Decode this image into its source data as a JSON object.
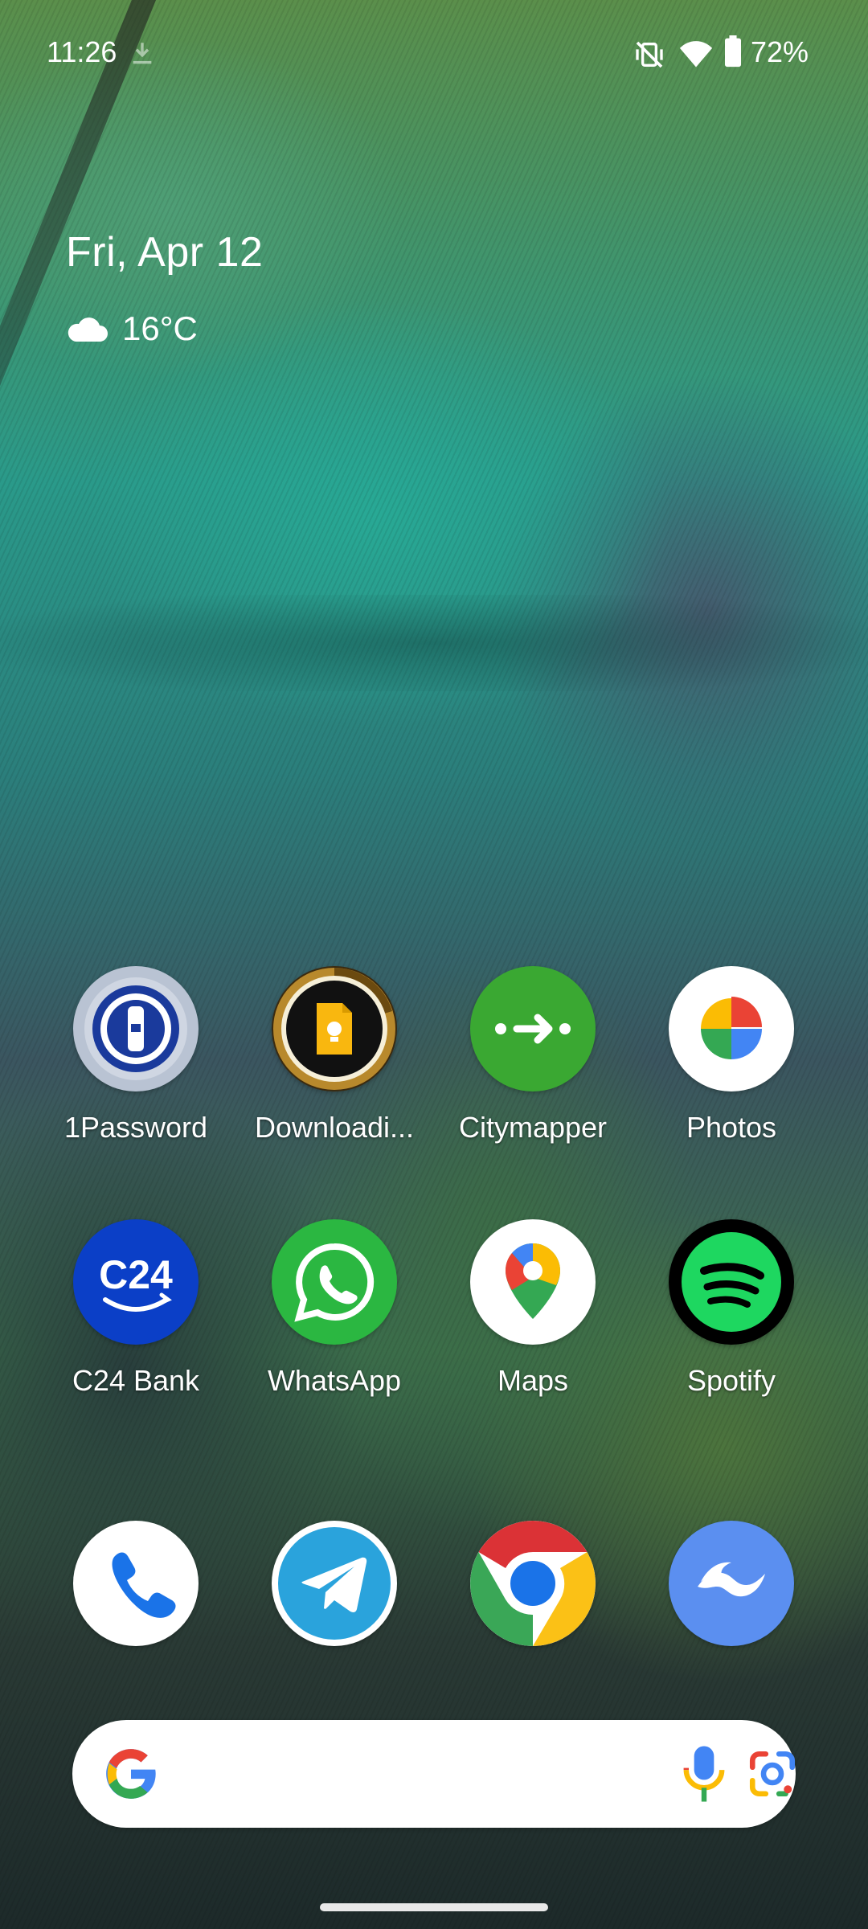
{
  "status_bar": {
    "time": "11:26",
    "battery": "72%",
    "icons": [
      "download-icon",
      "vibrate-off-icon",
      "wifi-icon",
      "battery-icon"
    ]
  },
  "glance": {
    "date": "Fri, Apr 12",
    "temperature": "16°C",
    "weather_icon": "cloud-icon"
  },
  "apps_row1": [
    {
      "label": "1Password",
      "icon": "1password-icon"
    },
    {
      "label": "Downloadi...",
      "icon": "google-keep-icon"
    },
    {
      "label": "Citymapper",
      "icon": "citymapper-icon"
    },
    {
      "label": "Photos",
      "icon": "photos-icon"
    }
  ],
  "apps_row2": [
    {
      "label": "C24 Bank",
      "icon": "c24-bank-icon"
    },
    {
      "label": "WhatsApp",
      "icon": "whatsapp-icon"
    },
    {
      "label": "Maps",
      "icon": "maps-icon"
    },
    {
      "label": "Spotify",
      "icon": "spotify-icon"
    }
  ],
  "c24_logo_text": "C24",
  "dock": [
    {
      "icon": "phone-icon"
    },
    {
      "icon": "telegram-icon"
    },
    {
      "icon": "chrome-icon"
    },
    {
      "icon": "app-icon-wave"
    }
  ],
  "search_bar": {
    "icons": [
      "google-g-icon",
      "microphone-icon",
      "google-lens-icon"
    ]
  },
  "colors": {
    "citymapper": "#3aa832",
    "c24": "#0b3fc7",
    "whatsapp": "#2bb741",
    "spotify": "#1ed760",
    "telegram": "#2aa3dc",
    "last_dock": "#5b8ff0"
  }
}
